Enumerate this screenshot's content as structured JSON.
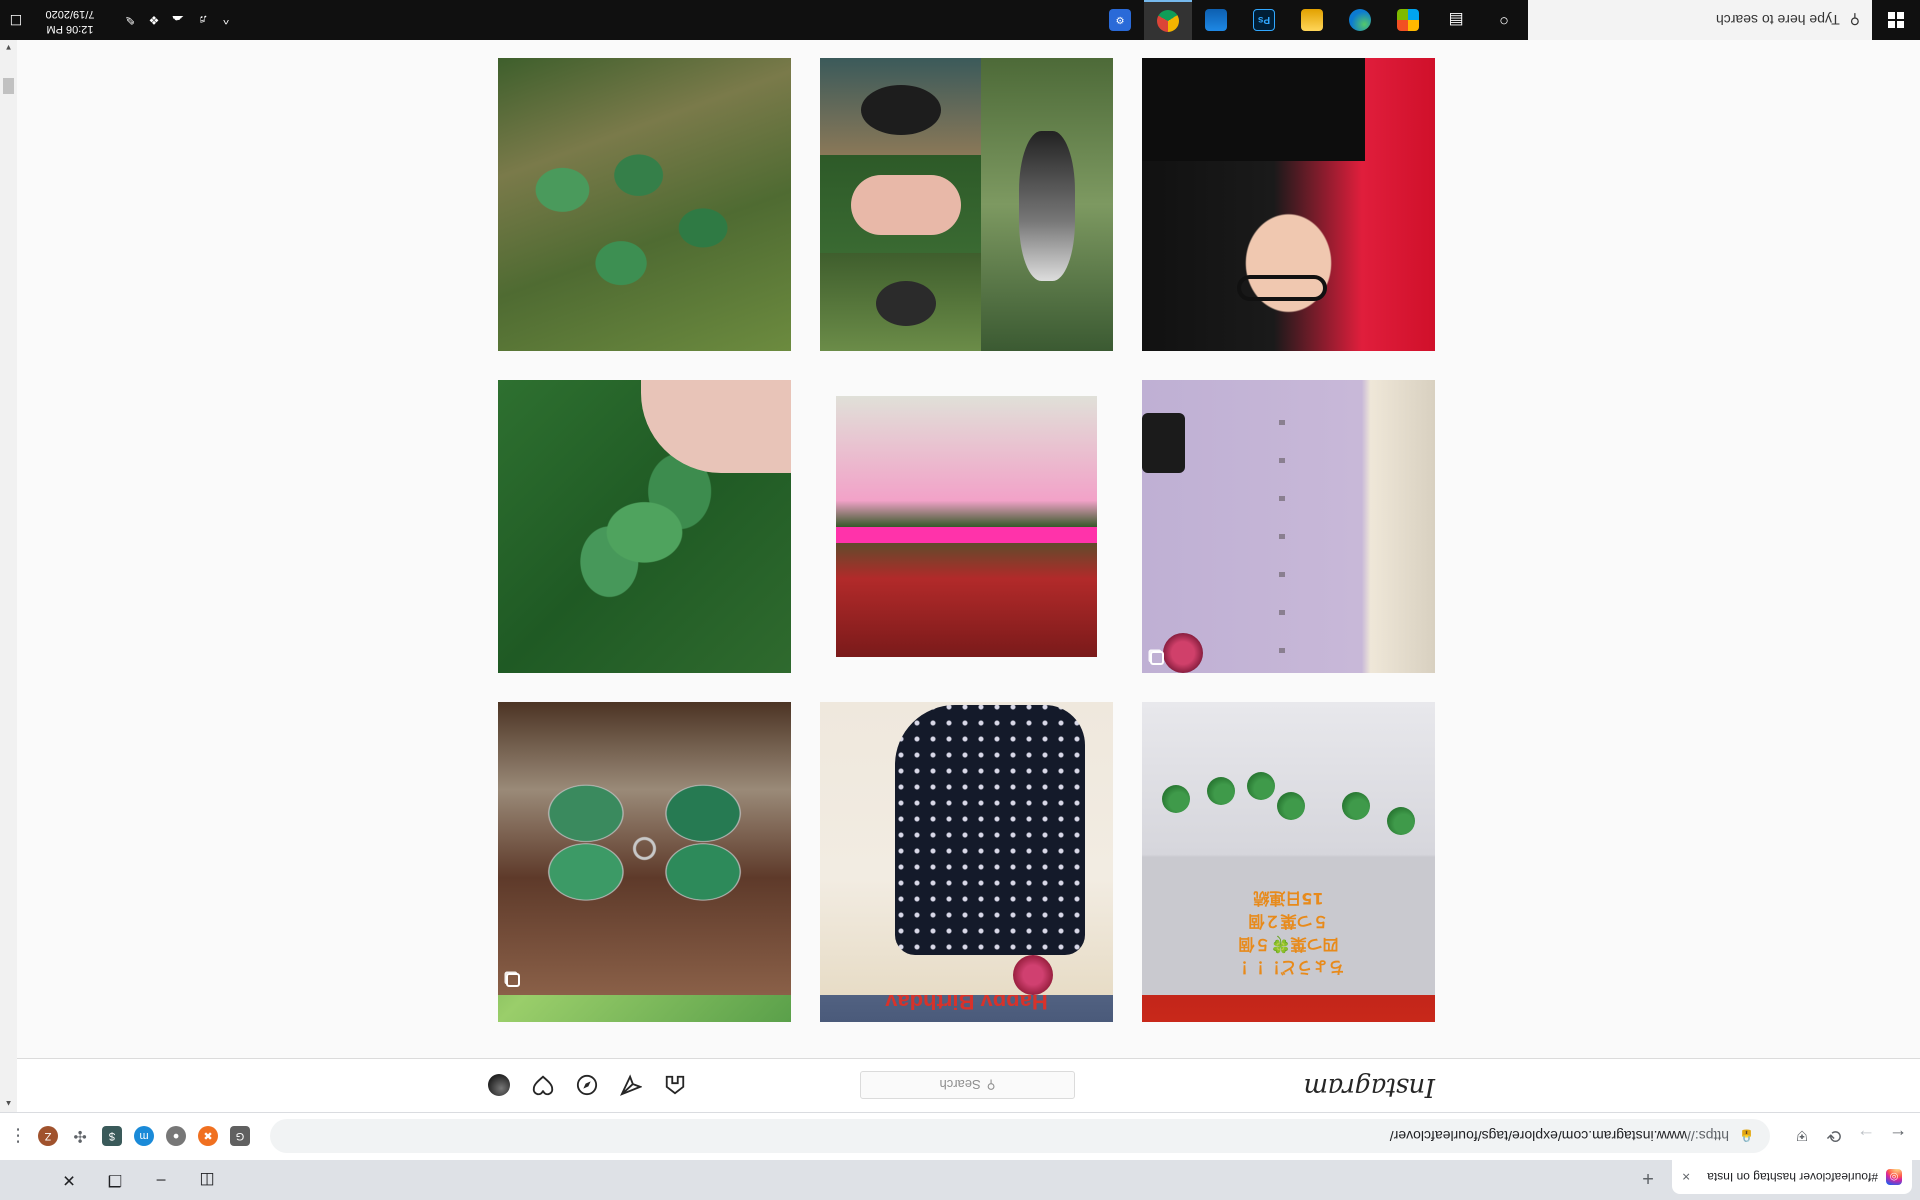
{
  "browser": {
    "tab_title": "#fourleafclover hashtag on Insta",
    "tab_close": "×",
    "new_tab": "+",
    "url_protocol": "https://",
    "url_rest": "www.instagram.com/explore/tags/fourleafclover/",
    "profile_initial": "Z",
    "back": "←",
    "forward": "→",
    "reload": "⟳",
    "menu": "⋮"
  },
  "instagram": {
    "logo": "Instagram",
    "search_placeholder": "Search",
    "search_glyph": "⚲",
    "nav_icons": [
      "home-icon",
      "direct-icon",
      "explore-icon",
      "activity-icon",
      "profile-avatar"
    ]
  },
  "grid": {
    "tiles": [
      {
        "name": "post-clover-grass",
        "style": "clover"
      },
      {
        "name": "post-dog-collage",
        "style": "collage"
      },
      {
        "name": "post-red-hair-selfie",
        "style": "redhair"
      },
      {
        "name": "post-four-leaf-in-hand",
        "style": "leaf"
      },
      {
        "name": "post-anime-art",
        "style": "anime"
      },
      {
        "name": "post-lilac-shirt",
        "style": "lilac",
        "multi": true
      },
      {
        "name": "post-stained-glass-clover",
        "style": "stained",
        "multi": true
      },
      {
        "name": "post-dot-dress",
        "style": "dress"
      },
      {
        "name": "post-clover-sprigs-text",
        "style": "jp"
      },
      {
        "name": "post-red-fabric",
        "style": "row4a"
      },
      {
        "name": "post-red-lettering",
        "style": "row4b"
      },
      {
        "name": "post-green-leaves",
        "style": "row4c"
      }
    ],
    "jp_lines": [
      "ちょうど！！！",
      "四つ葉🍀５個",
      "５つ葉２個",
      "15日連続"
    ],
    "red_lettering": "Happy Birthday"
  },
  "taskbar": {
    "search_placeholder": "Type here to search",
    "clock_time": "12:06 PM",
    "clock_date": "7/19/2020",
    "apps": [
      "cortana-icon",
      "task-view-icon",
      "store-icon",
      "edge-icon",
      "file-explorer-icon",
      "photoshop-icon",
      "mail-icon",
      "chrome-icon",
      "app-icon"
    ],
    "ps_label": "Ps",
    "tray_chevron": "^"
  },
  "colors": {
    "ig_bg": "#fafafa",
    "taskbar": "#101010",
    "jp_text": "#e88a1a"
  }
}
